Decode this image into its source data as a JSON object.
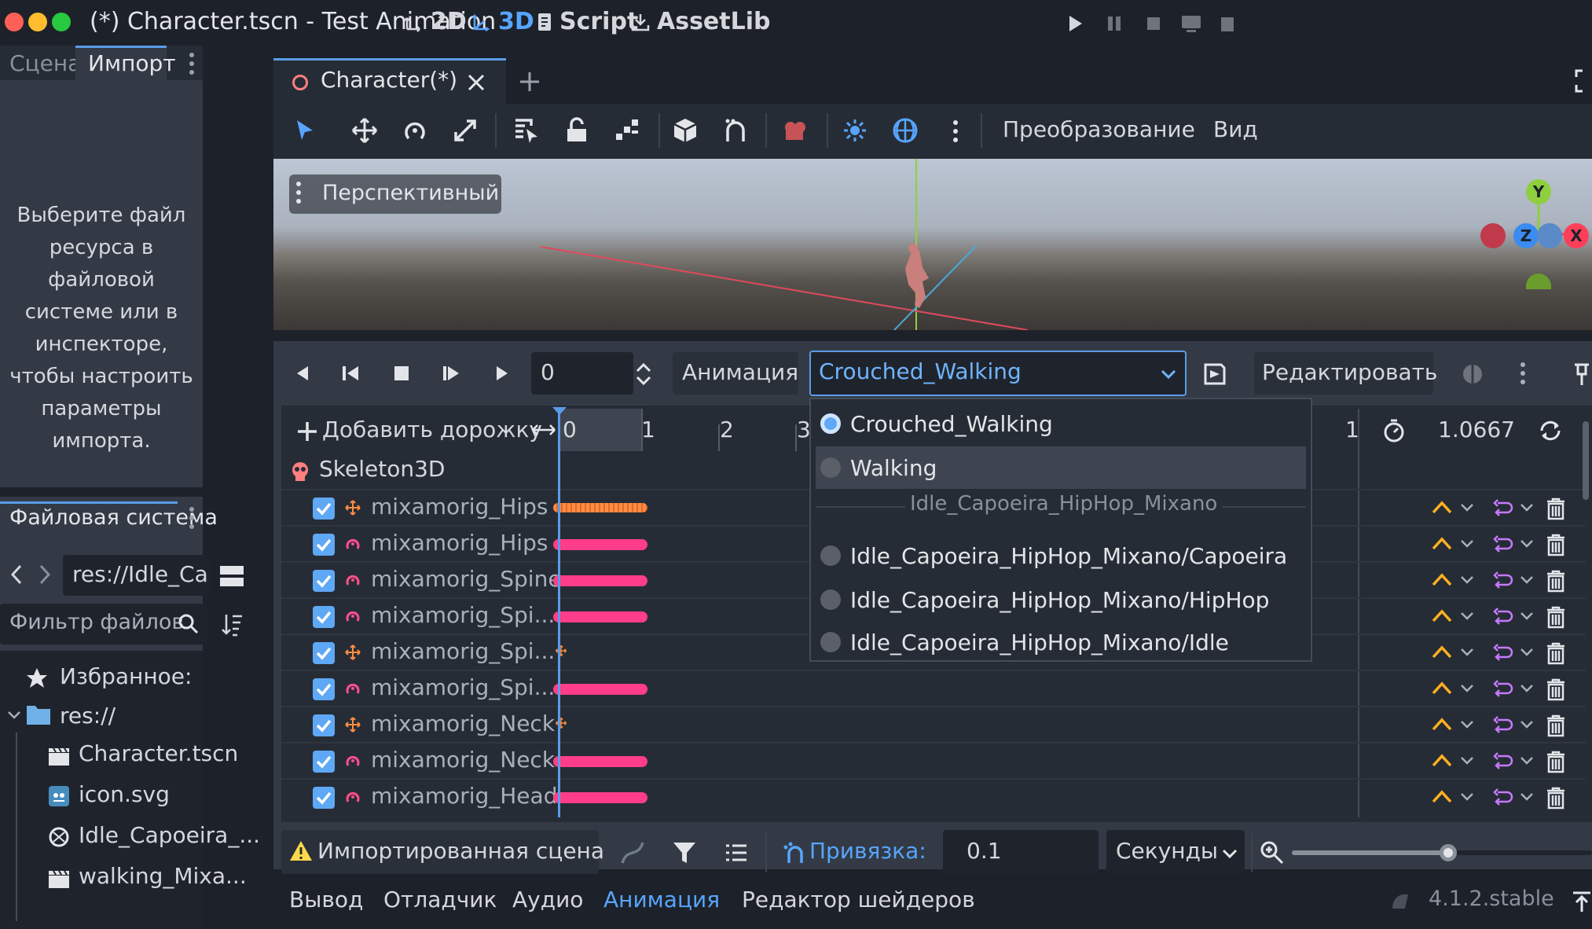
{
  "window": {
    "title": "(*) Character.tscn - Test Animation",
    "modes": [
      "2D",
      "3D",
      "Script",
      "AssetLib"
    ],
    "active_mode": "3D"
  },
  "scene_dock": {
    "tabs": [
      "Сцена",
      "Импорт"
    ],
    "active_tab": "Импорт",
    "import_message": "Выберите файл ресурса в файловой системе или в инспекторе, чтобы настроить параметры импорта."
  },
  "filesystem": {
    "title": "Файловая система",
    "path": "res://Idle_Ca",
    "filter_placeholder": "Фильтр файлов",
    "favorites_label": "Избранное:",
    "root": "res://",
    "files": [
      {
        "name": "Character.tscn",
        "icon": "clapperboard-icon"
      },
      {
        "name": "icon.svg",
        "icon": "godot-image-icon"
      },
      {
        "name": "Idle_Capoeira_...",
        "icon": "animated-scene-icon"
      },
      {
        "name": "walking_Mixa...",
        "icon": "clapperboard-icon"
      }
    ]
  },
  "editor": {
    "scene_tab": "Character(*)",
    "menu_transform": "Преобразование",
    "menu_view": "Вид",
    "viewport_label": "Перспективный",
    "gizmo": {
      "y": "Y",
      "z": "Z",
      "x": "X"
    }
  },
  "animation": {
    "time_value": "0",
    "animation_label": "Анимация",
    "selected_animation": "Crouched_Walking",
    "edit_button": "Редактировать",
    "add_track": "Добавить дорожку",
    "timeline_ticks": [
      "0",
      "1",
      "2",
      "3"
    ],
    "timeline_tick_right": "1",
    "length_value": "1.0667",
    "root_node": "Skeleton3D",
    "tracks": [
      {
        "name": "mixamorig_Hips",
        "kind": "position",
        "keys": true
      },
      {
        "name": "mixamorig_Hips",
        "kind": "rotation",
        "keys": true
      },
      {
        "name": "mixamorig_Spine",
        "kind": "rotation",
        "keys": true
      },
      {
        "name": "mixamorig_Spi...",
        "kind": "rotation",
        "keys": true
      },
      {
        "name": "mixamorig_Spi...",
        "kind": "position",
        "keys": false
      },
      {
        "name": "mixamorig_Spi...",
        "kind": "rotation",
        "keys": true
      },
      {
        "name": "mixamorig_Neck",
        "kind": "position",
        "keys": false
      },
      {
        "name": "mixamorig_Neck",
        "kind": "rotation",
        "keys": true
      },
      {
        "name": "mixamorig_Head",
        "kind": "rotation",
        "keys": true
      }
    ],
    "dropdown": {
      "items": [
        {
          "label": "Crouched_Walking",
          "selected": true
        },
        {
          "label": "Walking",
          "selected": false
        }
      ],
      "group_label": "Idle_Capoeira_HipHop_Mixano",
      "group_items": [
        "Idle_Capoeira_HipHop_Mixano/Capoeira",
        "Idle_Capoeira_HipHop_Mixano/HipHop",
        "Idle_Capoeira_HipHop_Mixano/Idle"
      ]
    },
    "imported_scene_warning": "Импортированная сцена",
    "snap_label": "Привязка:",
    "snap_value": "0.1",
    "snap_unit": "Секунды"
  },
  "bottom_panel": {
    "tabs": [
      "Вывод",
      "Отладчик",
      "Аудио",
      "Анимация",
      "Редактор шейдеров"
    ],
    "active_tab": "Анимация",
    "version": "4.1.2.stable"
  }
}
